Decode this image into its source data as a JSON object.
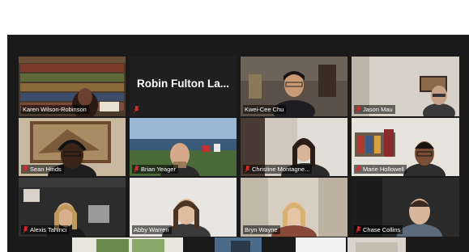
{
  "gallery": {
    "participants": [
      {
        "name": "Karen Wilson-Robinson",
        "video": true,
        "muted": false
      },
      {
        "name": "Robin Fulton La...",
        "video": false,
        "muted": true
      },
      {
        "name": "Kwei-Cee Chu",
        "video": true,
        "muted": false
      },
      {
        "name": "Jason Mau",
        "video": true,
        "muted": true
      },
      {
        "name": "Sean Hinds",
        "video": true,
        "muted": true
      },
      {
        "name": "Brian Yeager",
        "video": true,
        "muted": true
      },
      {
        "name": "Christine Montagne...",
        "video": true,
        "muted": true
      },
      {
        "name": "Marie Hollowell",
        "video": true,
        "muted": true
      },
      {
        "name": "Alexis Tahinci",
        "video": true,
        "muted": true
      },
      {
        "name": "Abby Warren",
        "video": true,
        "muted": false
      },
      {
        "name": "Bryn Wayne",
        "video": true,
        "muted": false
      },
      {
        "name": "Chase Collins",
        "video": true,
        "muted": true
      }
    ]
  },
  "colors": {
    "background": "#1a1a1a",
    "active_speaker_border": "#c8e03a",
    "muted_icon": "#e02828"
  },
  "icons": {
    "mute": "mic-muted-icon"
  }
}
